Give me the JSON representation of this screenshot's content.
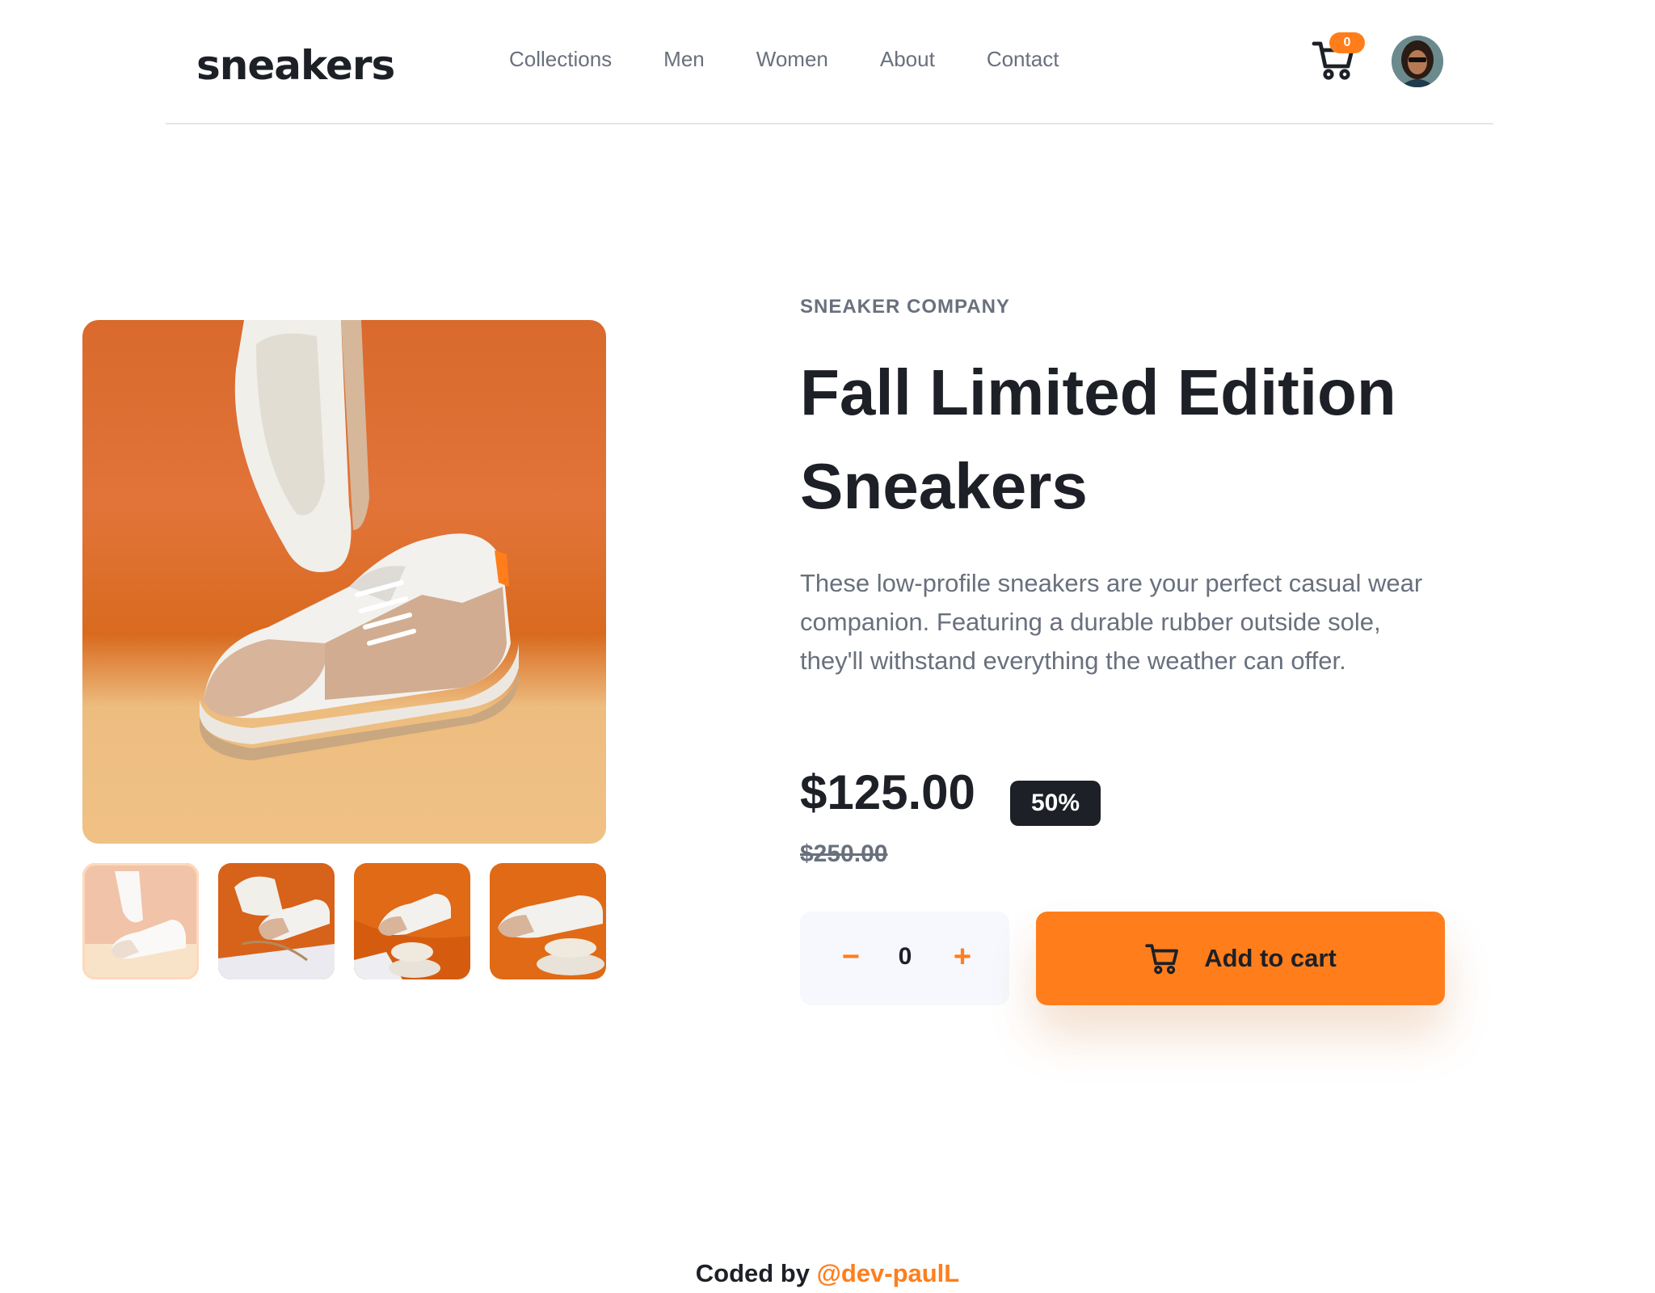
{
  "header": {
    "logo": "sneakers",
    "nav": [
      "Collections",
      "Men",
      "Women",
      "About",
      "Contact"
    ],
    "cart_count": "0"
  },
  "product": {
    "company": "SNEAKER COMPANY",
    "title": "Fall Limited Edition Sneakers",
    "description": "These low-profile sneakers are your perfect casual wear companion. Featuring a durable rubber outside sole, they'll withstand everything the weather can offer.",
    "price": "$125.00",
    "discount": "50%",
    "original_price": "$250.00",
    "quantity": "0",
    "minus_label": "−",
    "plus_label": "+",
    "add_to_cart_label": "Add to cart"
  },
  "gallery": {
    "active_thumbnail": 1,
    "thumbnail_count": 4
  },
  "footer": {
    "prefix": "Coded by ",
    "handle": "@dev-paulL"
  },
  "colors": {
    "accent": "#ff7e1b",
    "accent_pale": "#ffab6a",
    "dark": "#1d2026",
    "grey_text": "#69707d",
    "light_bg": "#f6f8fd"
  },
  "icons": {
    "cart": "cart-icon",
    "avatar": "user-avatar"
  }
}
